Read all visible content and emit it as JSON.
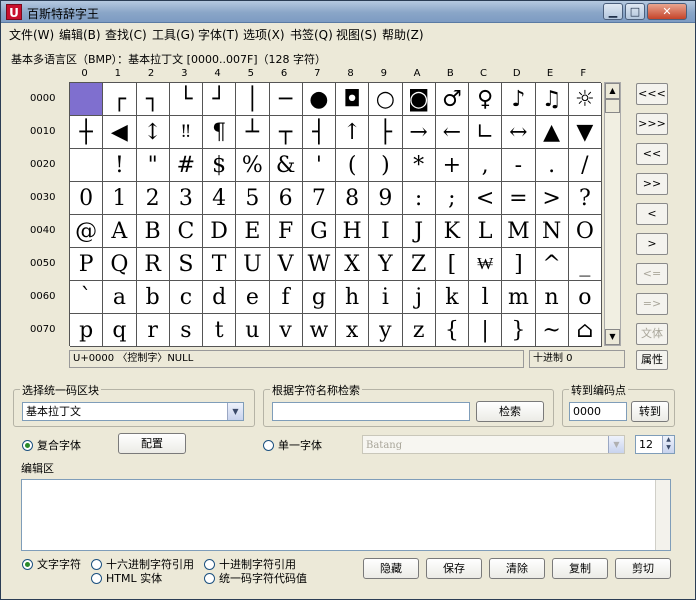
{
  "title": "百斯特辞字王",
  "menu": [
    "文件(W)",
    "编辑(B)",
    "查找(C)",
    "工具(G)",
    "字体(T)",
    "选项(X)",
    "书签(Q)",
    "视图(S)",
    "帮助(Z)"
  ],
  "charmap": {
    "range_label": "基本多语言区（BMP）：基本拉丁文 [0000..007F]（128 字符）",
    "columns": [
      "0",
      "1",
      "2",
      "3",
      "4",
      "5",
      "6",
      "7",
      "8",
      "9",
      "A",
      "B",
      "C",
      "D",
      "E",
      "F"
    ],
    "rows": [
      {
        "label": "0000",
        "cells": [
          "",
          "┌",
          "┐",
          "└",
          "┘",
          "│",
          "─",
          "●",
          "◘",
          "○",
          "◙",
          "♂",
          "♀",
          "♪",
          "♫",
          "☼"
        ]
      },
      {
        "label": "0010",
        "cells": [
          "┼",
          "◀",
          "↕",
          "‼",
          "¶",
          "┴",
          "┬",
          "┤",
          "↑",
          "├",
          "→",
          "←",
          "∟",
          "↔",
          "▲",
          "▼"
        ]
      },
      {
        "label": "0020",
        "cells": [
          "",
          "!",
          "\"",
          "#",
          "$",
          "%",
          "&",
          "'",
          "(",
          ")",
          "*",
          "+",
          ",",
          "-",
          ".",
          "/"
        ]
      },
      {
        "label": "0030",
        "cells": [
          "0",
          "1",
          "2",
          "3",
          "4",
          "5",
          "6",
          "7",
          "8",
          "9",
          ":",
          ";",
          "<",
          "=",
          ">",
          "?"
        ]
      },
      {
        "label": "0040",
        "cells": [
          "@",
          "A",
          "B",
          "C",
          "D",
          "E",
          "F",
          "G",
          "H",
          "I",
          "J",
          "K",
          "L",
          "M",
          "N",
          "O"
        ]
      },
      {
        "label": "0050",
        "cells": [
          "P",
          "Q",
          "R",
          "S",
          "T",
          "U",
          "V",
          "W",
          "X",
          "Y",
          "Z",
          "[",
          "₩",
          "]",
          "^",
          "_"
        ]
      },
      {
        "label": "0060",
        "cells": [
          "`",
          "a",
          "b",
          "c",
          "d",
          "e",
          "f",
          "g",
          "h",
          "i",
          "j",
          "k",
          "l",
          "m",
          "n",
          "o"
        ]
      },
      {
        "label": "0070",
        "cells": [
          "p",
          "q",
          "r",
          "s",
          "t",
          "u",
          "v",
          "w",
          "x",
          "y",
          "z",
          "{",
          "|",
          "}",
          "~",
          "⌂"
        ]
      }
    ],
    "selected": "0000",
    "status_char": "U+0000 〈控制字〉NULL",
    "status_decimal": "十进制 0",
    "scroll_position": 0
  },
  "side_buttons": [
    "<<<",
    ">>>",
    "<<",
    ">>",
    "<",
    ">",
    "<=",
    "=>",
    "文体"
  ],
  "properties_label": "属性",
  "unicode_block": {
    "label": "选择统一码区块",
    "value": "基本拉丁文"
  },
  "search": {
    "label": "根据字符名称检索",
    "value": "",
    "button": "检索"
  },
  "goto": {
    "label": "转到编码点",
    "value": "0000",
    "button": "转到"
  },
  "font": {
    "composite_label": "复合字体",
    "config_label": "配置",
    "single_label": "单一字体",
    "font_value": "Batang",
    "size_value": "12"
  },
  "edit": {
    "label": "编辑区",
    "options": [
      {
        "label": "文字字符",
        "checked": true
      },
      {
        "label": "十六进制字符引用",
        "checked": false
      },
      {
        "label": "十进制字符引用",
        "checked": false
      },
      {
        "label": "HTML 实体",
        "checked": false
      },
      {
        "label": "统一码字符代码值",
        "checked": false
      }
    ],
    "buttons": [
      "隐藏",
      "保存",
      "清除",
      "复制",
      "剪切"
    ]
  },
  "icons": {
    "app": "app-logo-icon",
    "minimize": "minimize-icon",
    "maximize": "maximize-icon",
    "close": "close-icon"
  }
}
